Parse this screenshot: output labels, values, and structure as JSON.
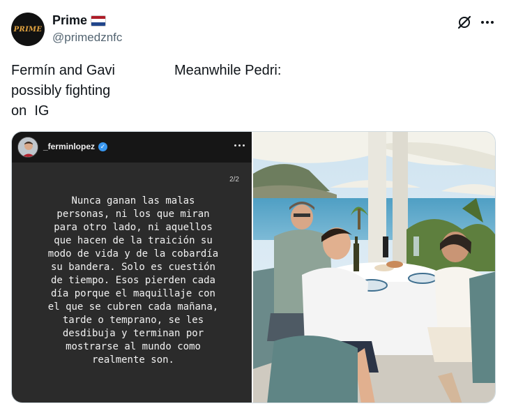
{
  "author": {
    "display_name": "Prime",
    "handle": "@primedznfc",
    "avatar_text": "PRIME",
    "flag_colors": [
      "#ae1c28",
      "#ffffff",
      "#21468b"
    ]
  },
  "tweet": {
    "left_lines": [
      "Fermín and Gavi",
      "possibly fighting",
      "on  IG"
    ],
    "right_lines": [
      "Meanwhile Pedri:"
    ]
  },
  "story": {
    "username": "_ferminlopez",
    "page": "2/2",
    "lines": [
      "Nunca ganan las malas",
      "personas, ni los que miran",
      "para otro lado, ni aquellos",
      "que hacen de la traición su",
      "modo de vida y de la cobardía",
      "su bandera. Solo es cuestión",
      "de tiempo. Esos pierden cada",
      "día porque el maquillaje con",
      "el que se cubren cada mañana,",
      "tarde o temprano, se les",
      "desdibuja y terminan por",
      "mostrarse al mundo como",
      "realmente son."
    ]
  },
  "icons": {
    "grok": "grok-icon",
    "more": "more-icon",
    "verified": "verified-badge-icon"
  },
  "colors": {
    "text": "#0f1419",
    "secondary": "#536471",
    "story_bg": "#2b2b2b",
    "verified": "#3897f0"
  }
}
